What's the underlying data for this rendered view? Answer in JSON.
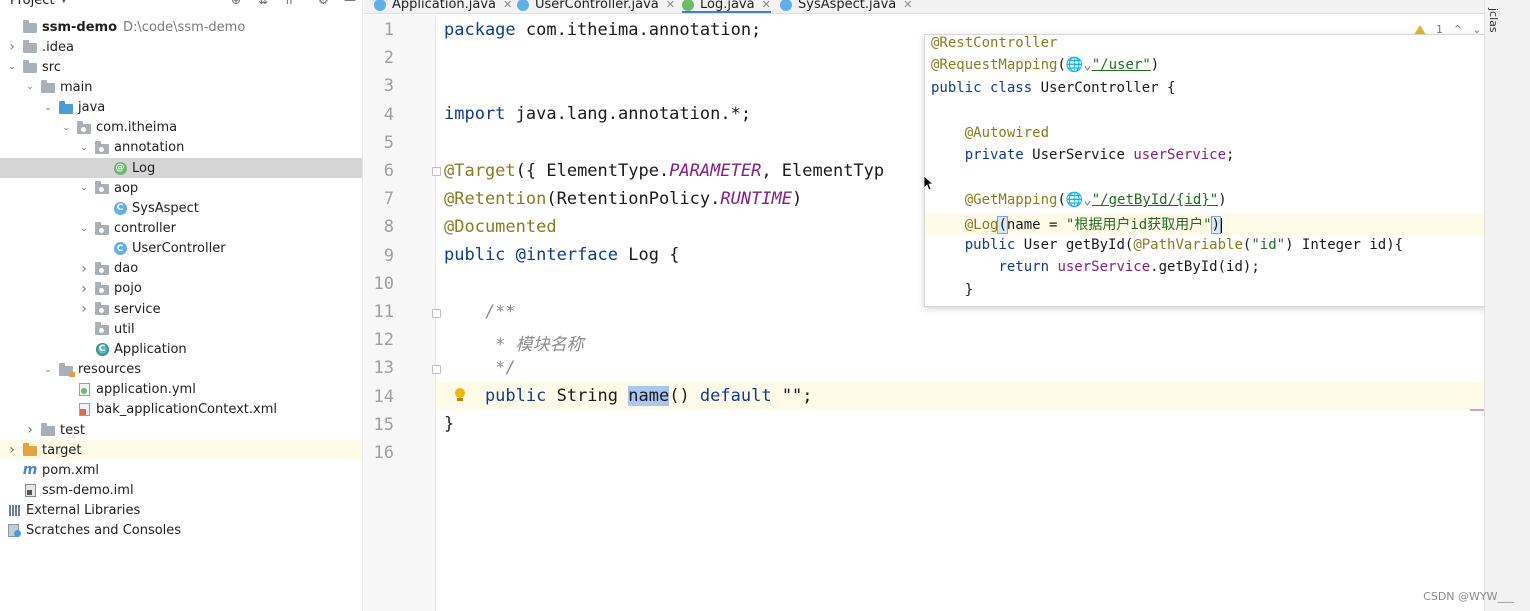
{
  "project_panel": {
    "title": "Project",
    "tree": [
      {
        "label": "ssm-demo",
        "path": "D:\\code\\ssm-demo",
        "bold": true,
        "depth": 0,
        "chevron": "",
        "icon": "folder-gray"
      },
      {
        "label": ".idea",
        "depth": 0,
        "chevron": "closed",
        "icon": "folder-gray"
      },
      {
        "label": "src",
        "depth": 0,
        "chevron": "open",
        "icon": "folder-gray"
      },
      {
        "label": "main",
        "depth": 1,
        "chevron": "open",
        "icon": "folder-gray"
      },
      {
        "label": "java",
        "depth": 2,
        "chevron": "open",
        "icon": "folder-blue"
      },
      {
        "label": "com.itheima",
        "depth": 3,
        "chevron": "open",
        "icon": "package"
      },
      {
        "label": "annotation",
        "depth": 4,
        "chevron": "open",
        "icon": "package"
      },
      {
        "label": "Log",
        "depth": 5,
        "chevron": "",
        "icon": "annotation",
        "selected": true
      },
      {
        "label": "aop",
        "depth": 4,
        "chevron": "open",
        "icon": "package"
      },
      {
        "label": "SysAspect",
        "depth": 5,
        "chevron": "",
        "icon": "class"
      },
      {
        "label": "controller",
        "depth": 4,
        "chevron": "open",
        "icon": "package"
      },
      {
        "label": "UserController",
        "depth": 5,
        "chevron": "",
        "icon": "class"
      },
      {
        "label": "dao",
        "depth": 4,
        "chevron": "closed",
        "icon": "package"
      },
      {
        "label": "pojo",
        "depth": 4,
        "chevron": "closed",
        "icon": "package"
      },
      {
        "label": "service",
        "depth": 4,
        "chevron": "closed",
        "icon": "package"
      },
      {
        "label": "util",
        "depth": 4,
        "chevron": "",
        "icon": "package"
      },
      {
        "label": "Application",
        "depth": 4,
        "chevron": "",
        "icon": "app-class"
      },
      {
        "label": "resources",
        "depth": 2,
        "chevron": "open",
        "icon": "folder-resources"
      },
      {
        "label": "application.yml",
        "depth": 3,
        "chevron": "",
        "icon": "yml"
      },
      {
        "label": "bak_applicationContext.xml",
        "depth": 3,
        "chevron": "",
        "icon": "xml"
      },
      {
        "label": "test",
        "depth": 1,
        "chevron": "closed",
        "icon": "folder-gray"
      },
      {
        "label": "target",
        "depth": 0,
        "chevron": "closed",
        "icon": "folder-orange",
        "target": true
      },
      {
        "label": "pom.xml",
        "depth": 0,
        "chevron": "",
        "icon": "maven"
      },
      {
        "label": "ssm-demo.iml",
        "depth": 0,
        "chevron": "",
        "icon": "iml"
      },
      {
        "label": "External Libraries",
        "depth": -1,
        "chevron": "",
        "icon": "libraries"
      },
      {
        "label": "Scratches and Consoles",
        "depth": -1,
        "chevron": "",
        "icon": "scratches"
      }
    ]
  },
  "tabs": [
    {
      "label": "Application.java",
      "icon": "class",
      "active": false
    },
    {
      "label": "UserController.java",
      "icon": "class",
      "active": false
    },
    {
      "label": "Log.java",
      "icon": "annotation",
      "active": true
    },
    {
      "label": "SysAspect.java",
      "icon": "class",
      "active": false
    }
  ],
  "editor": {
    "line_numbers": [
      "1",
      "2",
      "3",
      "4",
      "5",
      "6",
      "7",
      "8",
      "9",
      "10",
      "11",
      "12",
      "13",
      "14",
      "15",
      "16"
    ],
    "warnings_count": "1",
    "code": {
      "l1_kw": "package",
      "l1_rest": " com.itheima.annotation;",
      "l4_kw": "import",
      "l4_rest": " java.lang.annotation.*;",
      "l6_an": "@Target",
      "l6_a": "({ ElementType.",
      "l6_it": "PARAMETER",
      "l6_b": ", ElementTyp",
      "l7_an": "@Retention",
      "l7_a": "(RetentionPolicy.",
      "l7_it": "RUNTIME",
      "l7_b": ")",
      "l8_an": "@Documented",
      "l9_kw": "public",
      "l9_an": " @interface",
      "l9_rest": " Log {",
      "l11_cm": "    /**",
      "l12_cm": "     * 模块名称",
      "l13_cm": "     */",
      "l14_kw": "    public",
      "l14_a": " String ",
      "l14_sel": "name",
      "l14_b": "() ",
      "l14_kw2": "default",
      "l14_c": " \"\";",
      "l15": "}"
    }
  },
  "popup": {
    "l1_an": "@RestController",
    "l2_an": "@RequestMapping",
    "l2_open": "(",
    "l2_glb": "🌐⌄",
    "l2_url": "\"/user\"",
    "l2_close": ")",
    "l3_kw": "public class",
    "l3_rest": " UserController {",
    "l5_an": "@Autowired",
    "l6_kw": "private",
    "l6_a": " UserService ",
    "l6_fld": "userService",
    "l6_b": ";",
    "l8_an": "@GetMapping",
    "l8_open": "(",
    "l8_glb": "🌐⌄",
    "l8_url": "\"/getById/{id}\"",
    "l8_close": ")",
    "l9_an": "@Log",
    "l9_open": "(",
    "l9_a": "name = ",
    "l9_str": "\"根据用户id获取用户\"",
    "l9_close": ")",
    "l10_kw": "public",
    "l10_a": " User ",
    "l10_fn": "getById",
    "l10_b": "(",
    "l10_an": "@PathVariable",
    "l10_c": "(",
    "l10_str": "\"id\"",
    "l10_d": ") Integer id){",
    "l11_kw": "return",
    "l11_fld": " userService",
    "l11_a": ".getById(id);",
    "l12": "}"
  },
  "right_strip": {
    "label": "jclas"
  },
  "watermark": "CSDN @WYW___"
}
